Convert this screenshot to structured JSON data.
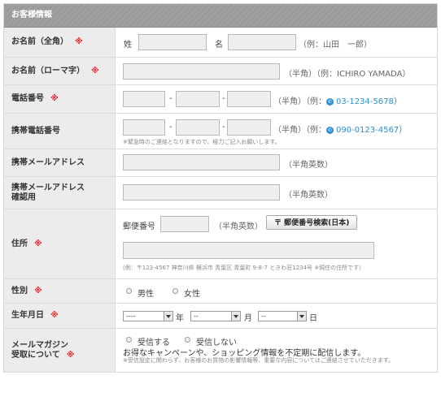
{
  "header": {
    "title": "お客様情報"
  },
  "required_mark": "※",
  "rows": {
    "name_kanji": {
      "label": "お名前（全角）",
      "sei": "姓",
      "mei": "名",
      "hint": "（例：山田　一郎）"
    },
    "name_roman": {
      "label": "お名前（ローマ字）",
      "hint": "（半角）（例：ICHIRO YAMADA）"
    },
    "phone": {
      "label": "電話番号",
      "sep": "-",
      "hint_pre": "（半角）（例：",
      "example": "03-1234-5678",
      "hint_post": "）"
    },
    "mobile": {
      "label": "携帯電話番号",
      "sep": "-",
      "hint_pre": "（半角）（例：",
      "example": "090-0123-4567",
      "hint_post": "）",
      "note": "※緊急時のご連絡となりますので、極力ご記入お願いします。"
    },
    "mobile_email": {
      "label": "携帯メールアドレス",
      "hint": "（半角英数）"
    },
    "mobile_email_confirm": {
      "label_line1": "携帯メールアドレス",
      "label_line2": "確認用",
      "hint": "（半角英数）"
    },
    "address": {
      "label": "住所",
      "zip_label": "郵便番号",
      "zip_hint": "（半角英数）",
      "zip_button": "〒 郵便番号検索(日本)",
      "note": "(例：〒123-4567 神奈川県 横浜市 青葉区 青葉町 9-8-7 ときわ荘1234号 ※現住の住所です）"
    },
    "gender": {
      "label": "性別",
      "male": "男性",
      "female": "女性"
    },
    "birthday": {
      "label": "生年月日",
      "year_value": "----",
      "year_unit": "年",
      "month_value": "--",
      "month_unit": "月",
      "day_value": "--",
      "day_unit": "日"
    },
    "newsletter": {
      "label_line1": "メールマガジン",
      "label_line2": "受取について",
      "opt_yes": "受信する",
      "opt_no": "受信しない",
      "desc": "お得なキャンペーンや、ショッピング情報を不定期に配信します。",
      "note": "※受信設定に関わらず、お客様のお買物の影響情報等、重要な内容についてはご連絡させていただきます。"
    }
  },
  "colors": {
    "header_bg": "#9a9a9a",
    "label_bg": "#ececec",
    "required": "#e8262b",
    "link": "#2b8fd4"
  }
}
